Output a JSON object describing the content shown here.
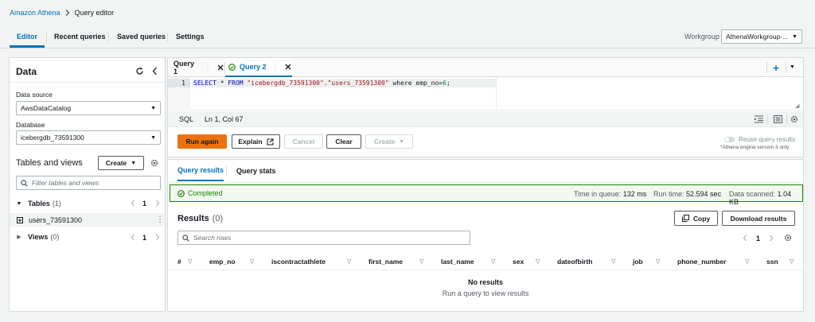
{
  "breadcrumb": {
    "root": "Amazon Athena",
    "current": "Query editor"
  },
  "top_tabs": [
    {
      "label": "Editor",
      "active": true
    },
    {
      "label": "Recent queries",
      "active": false
    },
    {
      "label": "Saved queries",
      "active": false
    },
    {
      "label": "Settings",
      "active": false
    }
  ],
  "workgroup": {
    "label": "Workgroup",
    "value": "AthenaWorkgroup-..."
  },
  "data_panel": {
    "title": "Data",
    "data_source_label": "Data source",
    "data_source_value": "AwsDataCatalog",
    "database_label": "Database",
    "database_value": "icebergdb_73591300",
    "tables_views_title": "Tables and views",
    "create_label": "Create",
    "filter_placeholder": "Filter tables and views",
    "tables_label": "Tables",
    "tables_count": "(1)",
    "tables_page": "1",
    "table_item": "users_73591300",
    "views_label": "Views",
    "views_count": "(0)",
    "views_page": "1"
  },
  "editor": {
    "tabs": [
      {
        "label": "Query 1",
        "active": false
      },
      {
        "label": "Query 2",
        "active": true
      }
    ],
    "line_number": "1",
    "query_parts": {
      "select": "SELECT",
      "rest1": " * ",
      "from": "FROM",
      "sp": " ",
      "db": "\"icebergdb_73591300\"",
      "dot": ".",
      "table": "\"users_73591300\"",
      "where": " where emp_no=",
      "num": "6",
      "semi": ";"
    },
    "lang": "SQL",
    "cursor_pos": "Ln 1, Col 67"
  },
  "actions": {
    "run_again": "Run again",
    "explain": "Explain",
    "cancel": "Cancel",
    "clear": "Clear",
    "create": "Create",
    "reuse_label": "Reuse query results",
    "engine_note": "*Athena engine version 3 only"
  },
  "result_tabs": [
    {
      "label": "Query results",
      "active": true
    },
    {
      "label": "Query stats",
      "active": false
    }
  ],
  "status": {
    "text": "Completed",
    "time_in_queue_label": "Time in queue:",
    "time_in_queue": "132 ms",
    "run_time_label": "Run time:",
    "run_time": "52.594 sec",
    "data_scanned_label": "Data scanned:",
    "data_scanned": "1.04 KB"
  },
  "results": {
    "title": "Results",
    "count": "(0)",
    "copy": "Copy",
    "download": "Download results",
    "search_placeholder": "Search rows",
    "page": "1",
    "columns": [
      "#",
      "emp_no",
      "iscontractathlete",
      "first_name",
      "last_name",
      "sex",
      "dateofbirth",
      "job",
      "phone_number",
      "ssn"
    ],
    "empty_title": "No results",
    "empty_sub": "Run a query to view results"
  },
  "colors": {
    "accent": "#0073bb",
    "primary_button": "#ec7211",
    "success": "#1d8102"
  }
}
